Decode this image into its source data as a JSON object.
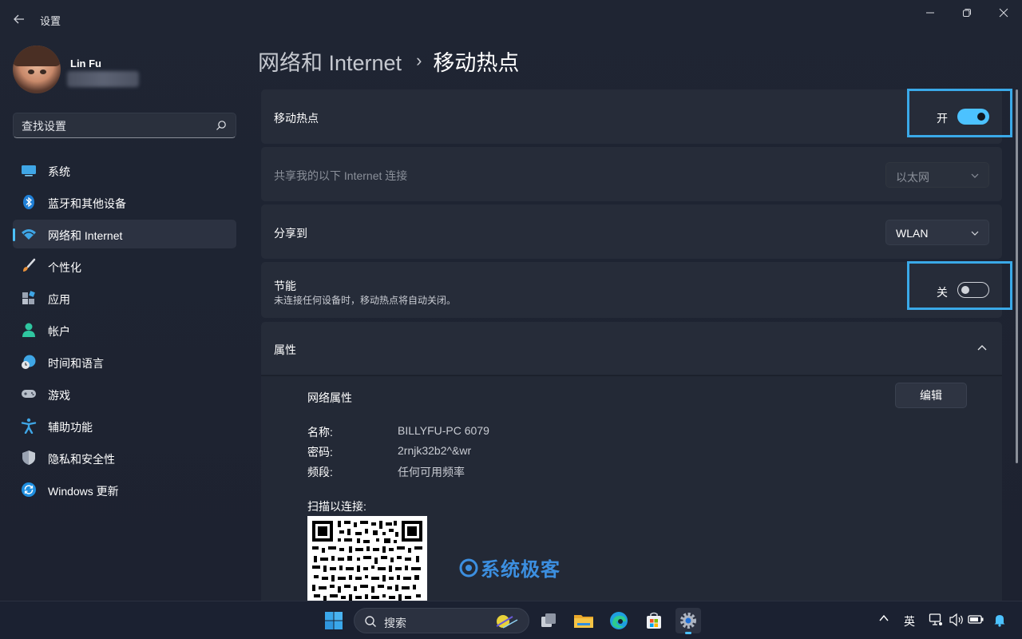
{
  "window": {
    "app_title": "设置",
    "back_icon": "back-arrow-icon",
    "controls": [
      "minimize-icon",
      "maximize-icon",
      "close-icon"
    ]
  },
  "profile": {
    "name": "Lin Fu"
  },
  "search": {
    "placeholder": "查找设置"
  },
  "sidebar": {
    "items": [
      {
        "label": "系统",
        "icon": "system-display-icon"
      },
      {
        "label": "蓝牙和其他设备",
        "icon": "bluetooth-icon"
      },
      {
        "label": "网络和 Internet",
        "icon": "wifi-icon",
        "active": true
      },
      {
        "label": "个性化",
        "icon": "paintbrush-icon"
      },
      {
        "label": "应用",
        "icon": "apps-icon"
      },
      {
        "label": "帐户",
        "icon": "account-icon"
      },
      {
        "label": "时间和语言",
        "icon": "globe-clock-icon"
      },
      {
        "label": "游戏",
        "icon": "gamepad-icon"
      },
      {
        "label": "辅助功能",
        "icon": "accessibility-icon"
      },
      {
        "label": "隐私和安全性",
        "icon": "shield-icon"
      },
      {
        "label": "Windows 更新",
        "icon": "windows-update-icon"
      }
    ]
  },
  "breadcrumb": {
    "parent": "网络和 Internet",
    "separator": "›",
    "current": "移动热点"
  },
  "hotspot": {
    "label": "移动热点",
    "state_text": "开",
    "on": true
  },
  "share_from": {
    "label": "共享我的以下 Internet 连接",
    "value": "以太网"
  },
  "share_to": {
    "label": "分享到",
    "value": "WLAN"
  },
  "power_saving": {
    "label": "节能",
    "description": "未连接任何设备时，移动热点将自动关闭。",
    "state_text": "关",
    "on": false
  },
  "properties": {
    "header": "属性",
    "network_props_label": "网络属性",
    "edit_label": "编辑",
    "rows": [
      {
        "key": "名称:",
        "value": "BILLYFU-PC 6079"
      },
      {
        "key": "密码:",
        "value": "2rnjk32b2^&wr"
      },
      {
        "key": "频段:",
        "value": "任何可用频率"
      }
    ],
    "scan_label": "扫描以连接:"
  },
  "watermark": {
    "text": "系统极客"
  },
  "taskbar": {
    "search_text": "搜索",
    "pinned": [
      "windows-start-icon",
      "search-icon",
      "task-view-icon",
      "file-explorer-icon",
      "edge-icon",
      "store-icon",
      "settings-icon"
    ],
    "tray": {
      "language": "英"
    }
  },
  "colors": {
    "accent": "#4cc2ff",
    "highlight_box": "#3aa9e8",
    "background": "#1f2533",
    "card": "#262c39"
  }
}
